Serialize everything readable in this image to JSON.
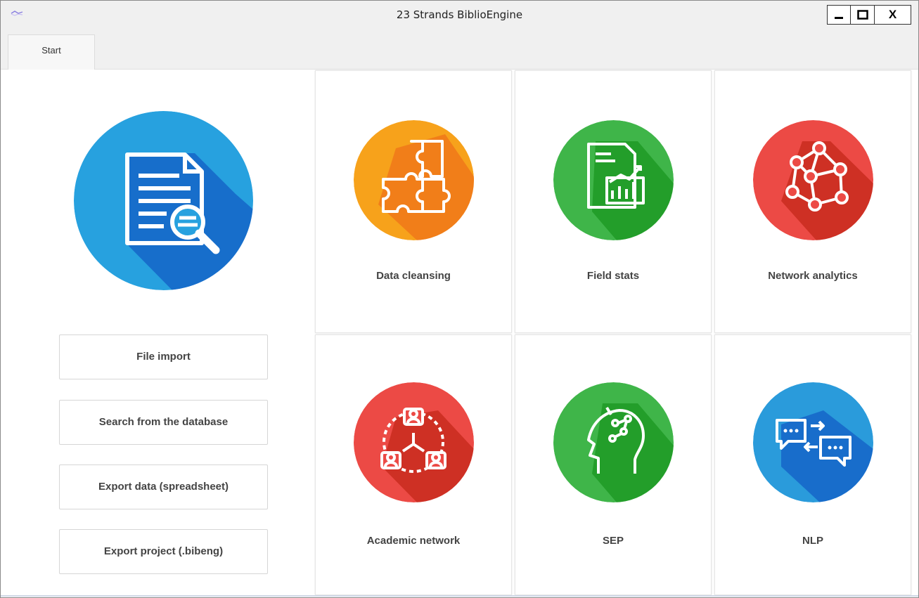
{
  "window": {
    "title": "23 Strands BiblioEngine",
    "controls": {
      "minimize": "minimize",
      "maximize": "maximize",
      "close": "X"
    }
  },
  "tabs": [
    {
      "label": "Start"
    }
  ],
  "left_panel": {
    "hero_icon": "document-search-icon",
    "buttons": [
      {
        "label": "File import"
      },
      {
        "label": "Search from the database"
      },
      {
        "label": "Export data (spreadsheet)"
      },
      {
        "label": "Export project (.bibeng)"
      }
    ]
  },
  "tiles": [
    {
      "label": "Data cleansing",
      "icon": "puzzle-icon",
      "color": "#f7a21b"
    },
    {
      "label": "Field stats",
      "icon": "report-chart-icon",
      "color": "#3fb549"
    },
    {
      "label": "Network analytics",
      "icon": "network-nodes-icon",
      "color": "#ec4a45"
    },
    {
      "label": "Academic network",
      "icon": "people-network-icon",
      "color": "#ec4a45"
    },
    {
      "label": "SEP",
      "icon": "head-idea-icon",
      "color": "#3fb549"
    },
    {
      "label": "NLP",
      "icon": "chat-bubbles-icon",
      "color": "#2a9bdb"
    }
  ]
}
